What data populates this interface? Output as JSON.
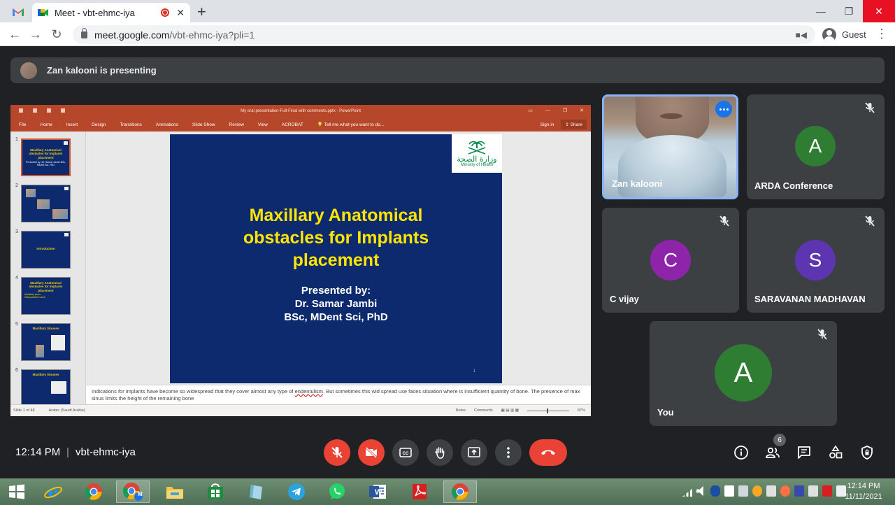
{
  "browser": {
    "tab_title": "Meet - vbt-ehmc-iya",
    "url_host": "meet.google.com",
    "url_path": "/vbt-ehmc-iya?pli=1",
    "profile": "Guest"
  },
  "meet": {
    "presenting_text": "Zan kalooni is presenting",
    "time": "12:14 PM",
    "divider": "|",
    "meeting_code": "vbt-ehmc-iya",
    "participants_count": "6",
    "colors": {
      "accent": "#8ab4f8",
      "danger": "#ea4335",
      "tile": "#3c4043"
    }
  },
  "powerpoint": {
    "window_title": "My oral presentation-Full-Final with comments.pptx - PowerPoint",
    "ribbon_tabs": [
      "File",
      "Home",
      "Insert",
      "Design",
      "Transitions",
      "Animations",
      "Slide Show",
      "Review",
      "View",
      "ACROBAT"
    ],
    "tell_me": "Tell me what you want to do...",
    "sign_in": "Sign in",
    "share": "Share",
    "thumbnails": [
      {
        "num": "1",
        "title": "Maxillary Anatomical obstacles for Implants placement",
        "sub": "Presented by: Dr. Samar Jambi BSc, MDent Sci, PhD"
      },
      {
        "num": "2",
        "title": "",
        "sub": ""
      },
      {
        "num": "3",
        "title": "Introduction",
        "sub": ""
      },
      {
        "num": "4",
        "title": "Maxillary Anatomical obstacles for Implants placement",
        "sub": "Maxillary sinus\nNasopalatine canal"
      },
      {
        "num": "5",
        "title": "Maxillary Sinuses",
        "sub": ""
      },
      {
        "num": "6",
        "title": "Maxillary Sinuses",
        "sub": ""
      }
    ],
    "slide": {
      "logo_arabic": "وزارة الصحة",
      "logo_english": "Ministry of Health",
      "title_lines": [
        "Maxillary Anatomical",
        "obstacles for Implants",
        "placement"
      ],
      "presented_lines": [
        "Presented by:",
        "Dr. Samar Jambi",
        "BSc, MDent Sci, PhD"
      ],
      "number": "1"
    },
    "notes_before": "Indications for implants have become so widespread that they cover almost any type of ",
    "notes_underlined": "endentulism",
    "notes_after": ". But sometimes this wid spread use faces situation where is insufficient quantity of bone. The presence of max sinus limits the height of the remaining bone",
    "status_slide": "Slide 1 of 48",
    "status_lang": "Arabic (Saudi Arabia)",
    "status_notes": "Notes",
    "status_comments": "Comments",
    "status_zoom": "87%"
  },
  "participants": [
    {
      "name": "Zan kalooni",
      "type": "video"
    },
    {
      "name": "ARDA Conference",
      "initial": "A",
      "color": "#2e7d32"
    },
    {
      "name": "C vijay",
      "initial": "C",
      "color": "#8e24aa"
    },
    {
      "name": "SARAVANAN MADHAVAN",
      "initial": "S",
      "color": "#5e35b1"
    },
    {
      "name": "You",
      "initial": "A",
      "color": "#2e7d32"
    }
  ],
  "taskbar": {
    "time": "12:14 PM",
    "date": "11/11/2021",
    "word_label": "W",
    "badge_label": "M"
  }
}
